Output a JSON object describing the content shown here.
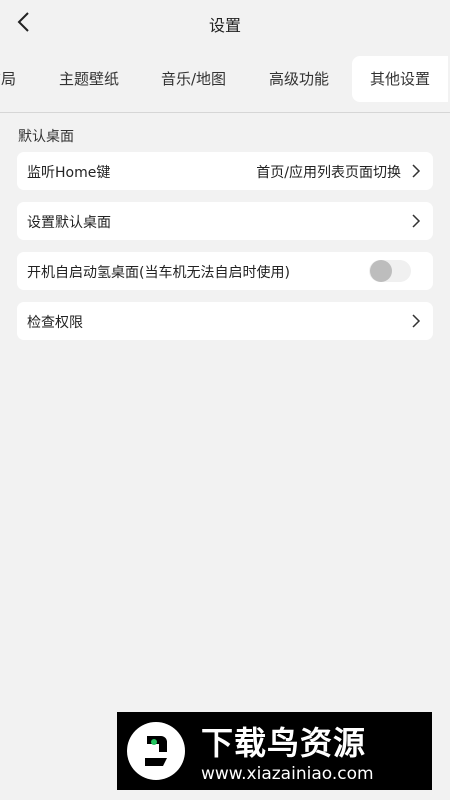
{
  "header": {
    "title": "设置"
  },
  "tabs": [
    {
      "label": "布局"
    },
    {
      "label": "主题壁纸"
    },
    {
      "label": "音乐/地图"
    },
    {
      "label": "高级功能"
    },
    {
      "label": "其他设置"
    }
  ],
  "section": {
    "title": "默认桌面"
  },
  "items": [
    {
      "label": "监听Home键",
      "value": "首页/应用列表页面切换"
    },
    {
      "label": "设置默认桌面"
    },
    {
      "label": "开机自启动氢桌面(当车机无法自启时使用)",
      "toggle_on": false
    },
    {
      "label": "检查权限"
    }
  ],
  "watermark": {
    "text": "下载鸟资源",
    "url": "www.xiazainiao.com"
  },
  "colors": {
    "background": "#f2f2f2",
    "card": "#ffffff",
    "toggle_knob": "#bdbdbd"
  }
}
